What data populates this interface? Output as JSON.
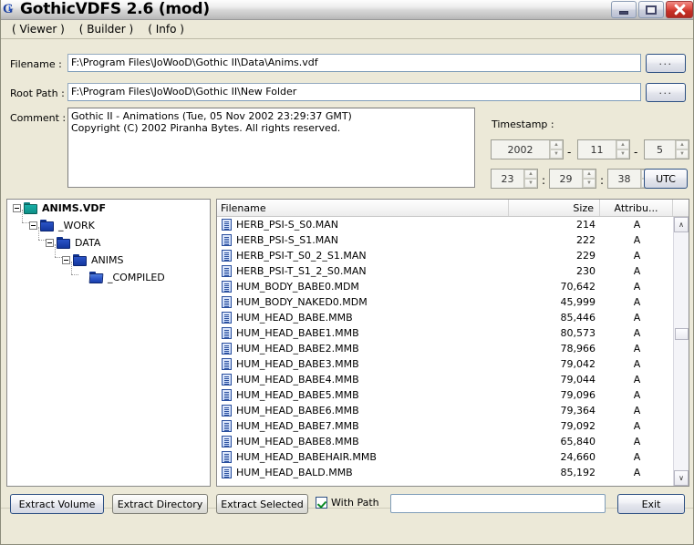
{
  "window": {
    "title": "GothicVDFS 2.6 (mod)",
    "icon": "app-logo-g-icon",
    "minimize_label": "minimize-icon",
    "maximize_label": "maximize-icon",
    "close_label": "close-icon"
  },
  "menu": {
    "items": [
      {
        "label": "( Viewer )"
      },
      {
        "label": "( Builder )"
      },
      {
        "label": "( Info )"
      }
    ]
  },
  "form": {
    "filename_label": "Filename :",
    "filename_value": "F:\\Program Files\\JoWooD\\Gothic II\\Data\\Anims.vdf",
    "root_path_label": "Root Path :",
    "root_path_value": "F:\\Program Files\\JoWooD\\Gothic II\\New Folder",
    "browse_label": "...",
    "comment_label": "Comment :",
    "comment_value": "Gothic II - Animations (Tue, 05 Nov 2002 23:29:37 GMT)\nCopyright (C) 2002 Piranha Bytes. All rights reserved."
  },
  "timestamp": {
    "label": "Timestamp :",
    "year": "2002",
    "month": "11",
    "day": "5",
    "hour": "23",
    "minute": "29",
    "second": "38",
    "date_separator": "-",
    "time_separator": ":",
    "utc_label": "UTC"
  },
  "tree": {
    "nodes": [
      {
        "label": "ANIMS.VDF",
        "depth": 0,
        "icon": "folder-teal-icon",
        "bold": true,
        "expanded": true
      },
      {
        "label": "_WORK",
        "depth": 1,
        "icon": "folder-blue-icon",
        "bold": false,
        "expanded": true
      },
      {
        "label": "DATA",
        "depth": 2,
        "icon": "folder-blue-icon",
        "bold": false,
        "expanded": true
      },
      {
        "label": "ANIMS",
        "depth": 3,
        "icon": "folder-blue-icon",
        "bold": false,
        "expanded": true
      },
      {
        "label": "_COMPILED",
        "depth": 4,
        "icon": "folder-open-blue-icon",
        "bold": false,
        "expanded": false
      }
    ]
  },
  "filelist": {
    "columns": [
      "Filename",
      "Size",
      "Attribu..."
    ],
    "rows": [
      {
        "name": "HERB_PSI-S_S0.MAN",
        "size": "214",
        "attr": "A"
      },
      {
        "name": "HERB_PSI-S_S1.MAN",
        "size": "222",
        "attr": "A"
      },
      {
        "name": "HERB_PSI-T_S0_2_S1.MAN",
        "size": "229",
        "attr": "A"
      },
      {
        "name": "HERB_PSI-T_S1_2_S0.MAN",
        "size": "230",
        "attr": "A"
      },
      {
        "name": "HUM_BODY_BABE0.MDM",
        "size": "70,642",
        "attr": "A"
      },
      {
        "name": "HUM_BODY_NAKED0.MDM",
        "size": "45,999",
        "attr": "A"
      },
      {
        "name": "HUM_HEAD_BABE.MMB",
        "size": "85,446",
        "attr": "A"
      },
      {
        "name": "HUM_HEAD_BABE1.MMB",
        "size": "80,573",
        "attr": "A"
      },
      {
        "name": "HUM_HEAD_BABE2.MMB",
        "size": "78,966",
        "attr": "A"
      },
      {
        "name": "HUM_HEAD_BABE3.MMB",
        "size": "79,042",
        "attr": "A"
      },
      {
        "name": "HUM_HEAD_BABE4.MMB",
        "size": "79,044",
        "attr": "A"
      },
      {
        "name": "HUM_HEAD_BABE5.MMB",
        "size": "79,096",
        "attr": "A"
      },
      {
        "name": "HUM_HEAD_BABE6.MMB",
        "size": "79,364",
        "attr": "A"
      },
      {
        "name": "HUM_HEAD_BABE7.MMB",
        "size": "79,092",
        "attr": "A"
      },
      {
        "name": "HUM_HEAD_BABE8.MMB",
        "size": "65,840",
        "attr": "A"
      },
      {
        "name": "HUM_HEAD_BABEHAIR.MMB",
        "size": "24,660",
        "attr": "A"
      },
      {
        "name": "HUM_HEAD_BALD.MMB",
        "size": "85,192",
        "attr": "A"
      }
    ],
    "scroll_up_glyph": "∧",
    "scroll_down_glyph": "∨"
  },
  "bottom": {
    "extract_volume": "Extract Volume",
    "extract_directory": "Extract Directory",
    "extract_selected": "Extract Selected",
    "with_path_label": "With Path",
    "with_path_checked": true,
    "path_value": "",
    "exit_label": "Exit"
  }
}
